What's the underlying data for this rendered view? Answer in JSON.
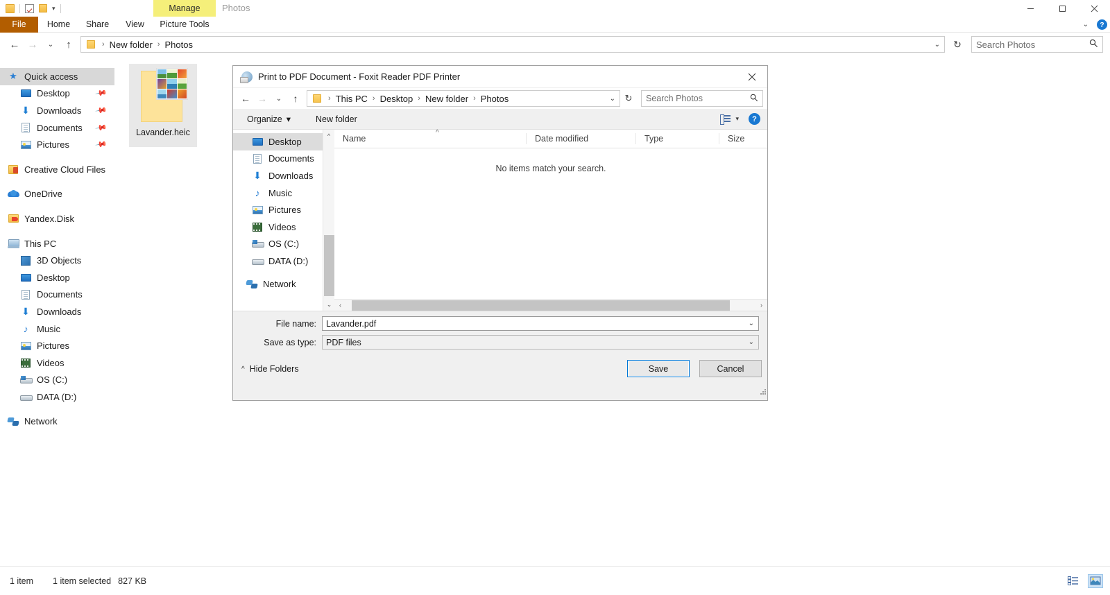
{
  "window": {
    "quick_access_toolbar": [
      "folder-icon",
      "properties-icon",
      "new-folder-icon",
      "customize-caret"
    ],
    "context_tab_group": "Manage",
    "app_title": "Photos",
    "controls": {
      "minimize": "minimize-icon",
      "maximize": "maximize-icon",
      "close": "close-icon"
    }
  },
  "ribbon": {
    "tabs": [
      {
        "label": "File"
      },
      {
        "label": "Home"
      },
      {
        "label": "Share"
      },
      {
        "label": "View"
      },
      {
        "label": "Picture Tools"
      }
    ],
    "expand_label": "chevron-down-icon",
    "help_label": "?"
  },
  "address_bar": {
    "back": "back-arrow-icon",
    "forward": "forward-arrow-icon",
    "recent": "recent-locations-icon",
    "up": "up-arrow-icon",
    "crumbs": [
      "New folder",
      "Photos"
    ],
    "separator": "›",
    "refresh": "refresh-icon",
    "search": {
      "placeholder": "Search Photos",
      "value": ""
    }
  },
  "sidebar": {
    "items": [
      {
        "label": "Quick access",
        "icon": "star-icon",
        "selected": true,
        "indent": 0,
        "pinned": false
      },
      {
        "label": "Desktop",
        "icon": "desktop-icon",
        "indent": 1,
        "pinned": true
      },
      {
        "label": "Downloads",
        "icon": "downloads-icon",
        "indent": 1,
        "pinned": true
      },
      {
        "label": "Documents",
        "icon": "documents-icon",
        "indent": 1,
        "pinned": true
      },
      {
        "label": "Pictures",
        "icon": "pictures-icon",
        "indent": 1,
        "pinned": true
      },
      {
        "label": "Creative Cloud Files",
        "icon": "creative-cloud-icon",
        "indent": 0,
        "pinned": false
      },
      {
        "label": "OneDrive",
        "icon": "onedrive-icon",
        "indent": 0,
        "pinned": false
      },
      {
        "label": "Yandex.Disk",
        "icon": "yandex-disk-icon",
        "indent": 0,
        "pinned": false
      },
      {
        "label": "This PC",
        "icon": "this-pc-icon",
        "indent": 0,
        "pinned": false
      },
      {
        "label": "3D Objects",
        "icon": "3d-objects-icon",
        "indent": 1,
        "pinned": false
      },
      {
        "label": "Desktop",
        "icon": "desktop-icon",
        "indent": 1,
        "pinned": false
      },
      {
        "label": "Documents",
        "icon": "documents-icon",
        "indent": 1,
        "pinned": false
      },
      {
        "label": "Downloads",
        "icon": "downloads-icon",
        "indent": 1,
        "pinned": false
      },
      {
        "label": "Music",
        "icon": "music-icon",
        "indent": 1,
        "pinned": false
      },
      {
        "label": "Pictures",
        "icon": "pictures-icon",
        "indent": 1,
        "pinned": false
      },
      {
        "label": "Videos",
        "icon": "videos-icon",
        "indent": 1,
        "pinned": false
      },
      {
        "label": "OS (C:)",
        "icon": "os-drive-icon",
        "indent": 1,
        "pinned": false
      },
      {
        "label": "DATA (D:)",
        "icon": "drive-icon",
        "indent": 1,
        "pinned": false
      },
      {
        "label": "Network",
        "icon": "network-icon",
        "indent": 0,
        "pinned": false
      }
    ]
  },
  "content": {
    "files": [
      {
        "name": "Lavander.heic",
        "selected": true
      }
    ]
  },
  "status_bar": {
    "item_count": "1 item",
    "selection": "1 item selected",
    "size": "827 KB",
    "views": {
      "details": "details-view-icon",
      "large_icons": "large-icons-view-icon"
    }
  },
  "dialog": {
    "title": "Print to PDF Document - Foxit Reader PDF Printer",
    "close": "close-icon",
    "address_bar": {
      "back": "back-arrow-icon",
      "forward": "forward-arrow-icon",
      "recent": "recent-locations-icon",
      "up": "up-arrow-icon",
      "crumbs": [
        "This PC",
        "Desktop",
        "New folder",
        "Photos"
      ],
      "separator": "›",
      "refresh": "refresh-icon",
      "search": {
        "placeholder": "Search Photos",
        "value": ""
      }
    },
    "toolbar": {
      "organize": "Organize",
      "organize_caret": "▾",
      "new_folder": "New folder",
      "view_icon": "change-view-icon",
      "view_caret": "▾",
      "help": "?"
    },
    "tree": [
      {
        "label": "Desktop",
        "icon": "desktop-icon",
        "selected": true
      },
      {
        "label": "Documents",
        "icon": "documents-icon"
      },
      {
        "label": "Downloads",
        "icon": "downloads-icon"
      },
      {
        "label": "Music",
        "icon": "music-icon"
      },
      {
        "label": "Pictures",
        "icon": "pictures-icon"
      },
      {
        "label": "Videos",
        "icon": "videos-icon"
      },
      {
        "label": "OS (C:)",
        "icon": "os-drive-icon"
      },
      {
        "label": "DATA (D:)",
        "icon": "drive-icon"
      },
      {
        "label": "Network",
        "icon": "network-icon"
      }
    ],
    "file_list": {
      "columns": [
        "Name",
        "Date modified",
        "Type",
        "Size"
      ],
      "sort_indicator": "^",
      "rows": [],
      "empty_message": "No items match your search."
    },
    "fields": {
      "file_name_label": "File name:",
      "file_name_value": "Lavander.pdf",
      "save_as_type_label": "Save as type:",
      "save_as_type_value": "PDF files",
      "caret": "⌄"
    },
    "footer": {
      "hide_folders": "Hide Folders",
      "hide_folders_caret": "^",
      "save_button": "Save",
      "cancel_button": "Cancel"
    }
  }
}
